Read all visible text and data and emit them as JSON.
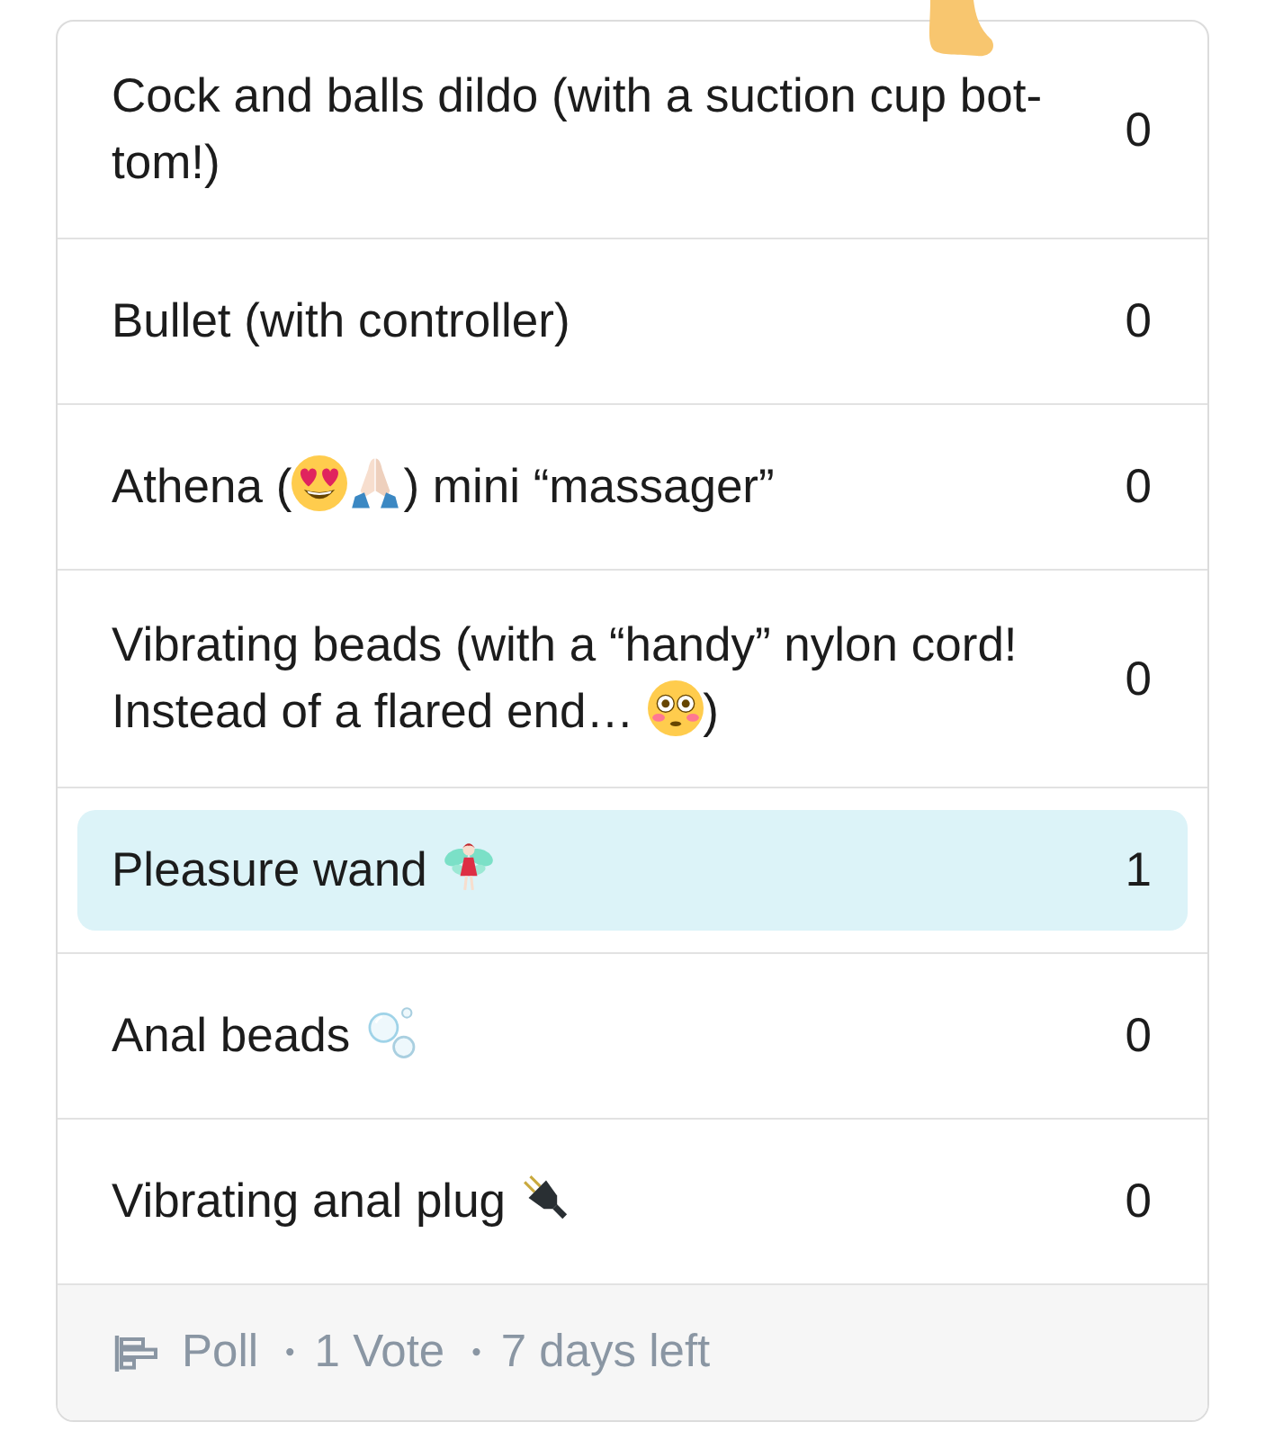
{
  "options": [
    {
      "parts": [
        {
          "kind": "text",
          "text": "Cock and balls dildo (with a suction cup bot-tom!)"
        }
      ],
      "votes": "0",
      "selected": false
    },
    {
      "parts": [
        {
          "kind": "text",
          "text": "Bullet (with controller)"
        }
      ],
      "votes": "0",
      "selected": false
    },
    {
      "parts": [
        {
          "kind": "text",
          "text": "Athena ("
        },
        {
          "kind": "emoji"
        },
        {
          "kind": "emoji"
        },
        {
          "kind": "text",
          "text": ") mini “massager”"
        }
      ],
      "votes": "0",
      "selected": false
    },
    {
      "parts": [
        {
          "kind": "text",
          "text": "Vibrating beads (with a “handy” nylon cord! Instead of a flared end… "
        },
        {
          "kind": "emoji"
        },
        {
          "kind": "text",
          "text": ")"
        }
      ],
      "votes": "0",
      "selected": false
    },
    {
      "parts": [
        {
          "kind": "text",
          "text": "Pleasure wand "
        },
        {
          "kind": "emoji"
        }
      ],
      "votes": "1",
      "selected": true
    },
    {
      "parts": [
        {
          "kind": "text",
          "text": "Anal beads "
        },
        {
          "kind": "emoji"
        }
      ],
      "votes": "0",
      "selected": false
    },
    {
      "parts": [
        {
          "kind": "text",
          "text": "Vibrating anal plug "
        },
        {
          "kind": "emoji"
        }
      ],
      "votes": "0",
      "selected": false
    }
  ],
  "footer": {
    "label": "Poll",
    "details": [
      {
        "separator": "•",
        "text": "1 Vote"
      },
      {
        "separator": "•",
        "text": "7 days left"
      }
    ]
  }
}
